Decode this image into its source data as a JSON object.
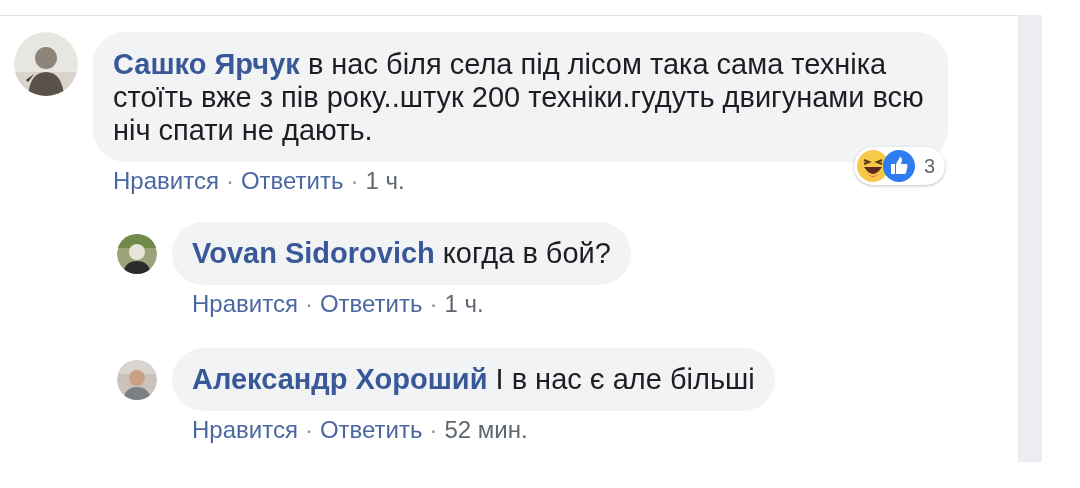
{
  "comments": [
    {
      "author": "Сашко Ярчук",
      "text": "в нас біля села під лісом така сама техніка стоїть вже з пів року..штук 200 техніки.гудуть двигунами всю ніч спати не дають.",
      "actions": [
        "Нравится",
        "Ответить",
        "1 ч."
      ],
      "separator": "·",
      "reactions": {
        "items": [
          {
            "kind": "haha"
          },
          {
            "kind": "like"
          }
        ],
        "count": "3"
      },
      "replies": [
        {
          "author": "Vovan Sidorovich",
          "text": "когда в бой?",
          "actions": [
            "Нравится",
            "Ответить",
            "1 ч."
          ]
        },
        {
          "author": "Александр Хороший",
          "text": "І в нас є але більші",
          "actions": [
            "Нравится",
            "Ответить",
            "52 мин."
          ]
        }
      ]
    }
  ]
}
